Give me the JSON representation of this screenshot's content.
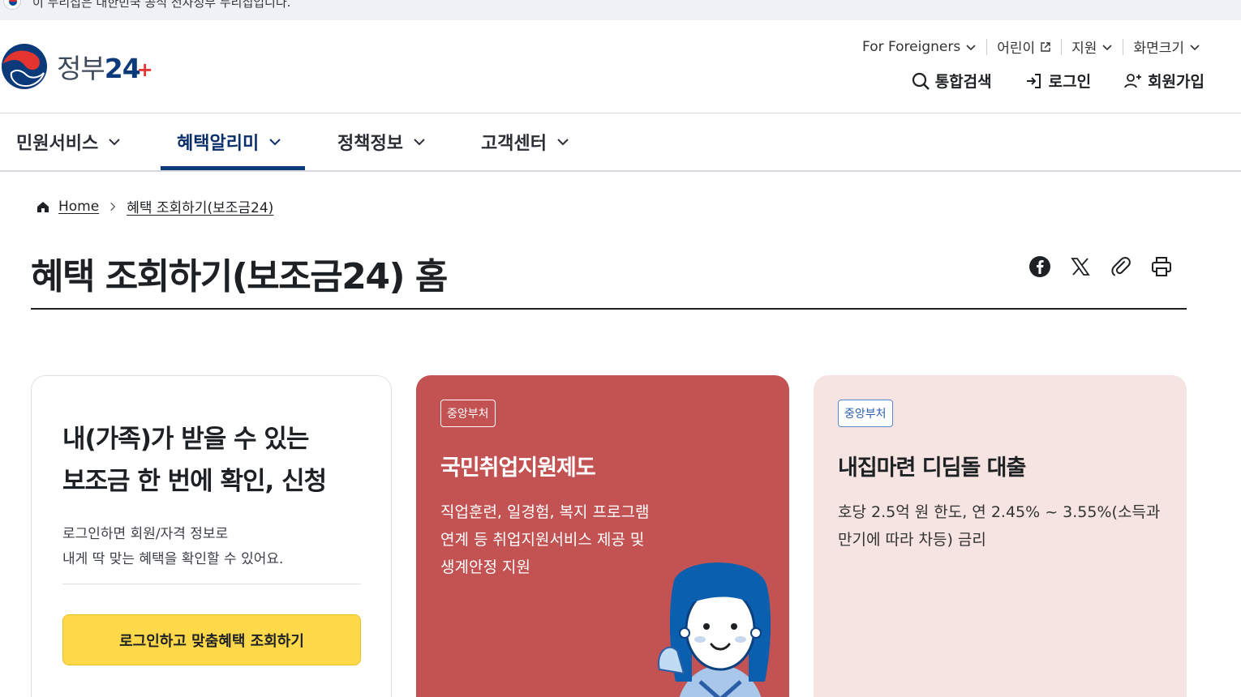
{
  "banner": {
    "text": "이 누리집은 대한민국 공식 전자정부 누리집입니다."
  },
  "logo": {
    "text": "정부",
    "num": "24",
    "plus": "+"
  },
  "util_nav": [
    {
      "label": "For Foreigners",
      "icon": "chevron-down-icon"
    },
    {
      "label": "어린이",
      "icon": "external-link-icon"
    },
    {
      "label": "지원",
      "icon": "chevron-down-icon"
    },
    {
      "label": "화면크기",
      "icon": "chevron-down-icon"
    }
  ],
  "action_nav": [
    {
      "label": "통합검색",
      "icon": "search-icon"
    },
    {
      "label": "로그인",
      "icon": "login-icon"
    },
    {
      "label": "회원가입",
      "icon": "user-plus-icon"
    }
  ],
  "main_nav": [
    {
      "label": "민원서비스",
      "active": false
    },
    {
      "label": "혜택알리미",
      "active": true
    },
    {
      "label": "정책정보",
      "active": false
    },
    {
      "label": "고객센터",
      "active": false
    }
  ],
  "breadcrumb": {
    "home": "Home",
    "current": "혜택 조회하기(보조금24)"
  },
  "page": {
    "title": "혜택 조회하기(보조금24) 홈"
  },
  "share_tools": [
    "facebook-icon",
    "x-icon",
    "link-icon",
    "print-icon"
  ],
  "login_card": {
    "headline_1": "내(가족)가 받을 수 있는",
    "headline_2": "보조금 한 번에 확인, 신청",
    "desc_1": "로그인하면 회원/자격 정보로",
    "desc_2": "내게 딱 맞는 혜택을 확인할 수 있어요.",
    "cta": "로그인하고 맞춤혜택 조회하기"
  },
  "benefit_cards": [
    {
      "badge": "중앙부처",
      "title": "국민취업지원제도",
      "desc": "직업훈련, 일경험, 복지 프로그램 연계 등 취업지원서비스 제공 및 생계안정 지원",
      "color": "#c35353"
    },
    {
      "badge": "중앙부처",
      "title": "내집마련 디딤돌 대출",
      "desc": "호당 2.5억 원 한도, 연 2.45% ~ 3.55%(소득과 만기에 따라 차등) 금리",
      "color": "#f5e4e1"
    }
  ],
  "colors": {
    "brand_navy": "#0b3a7a",
    "cta_yellow": "#ffd94a",
    "accent_red": "#e3342f"
  }
}
